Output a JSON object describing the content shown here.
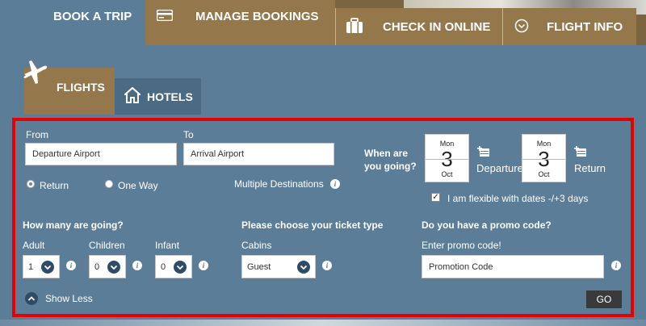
{
  "nav": {
    "book_label": "BOOK A TRIP",
    "manage_label": "MANAGE BOOKINGS",
    "checkin_label": "CHECK IN ONLINE",
    "info_label": "FLIGHT INFO"
  },
  "tabs": {
    "flights_label": "FLIGHTS",
    "hotels_label": "HOTELS"
  },
  "form": {
    "from_label": "From",
    "from_value": "Departure Airport",
    "to_label": "To",
    "to_value": "Arrival Airport",
    "trip_types": [
      "Return",
      "One Way"
    ],
    "selected_trip_type": "Return",
    "multi_dest_label": "Multiple Destinations",
    "when_label_line1": "When are",
    "when_label_line2": "you going?",
    "departure": {
      "dow": "Mon",
      "day": "3",
      "month": "Oct",
      "label": "Departure"
    },
    "return": {
      "dow": "Mon",
      "day": "3",
      "month": "Oct",
      "label": "Return"
    },
    "flexible_label": "I am flexible with dates -/+3 days",
    "flexible_checked": true,
    "passengers_heading": "How many are going?",
    "adult_label": "Adult",
    "adult_value": "1",
    "children_label": "Children",
    "children_value": "0",
    "infant_label": "Infant",
    "infant_value": "0",
    "ticket_heading": "Please choose your ticket type",
    "cabins_label": "Cabins",
    "cabins_value": "Guest",
    "promo_heading": "Do you have a promo code?",
    "promo_label": "Enter promo code!",
    "promo_value": "Promotion Code",
    "show_less_label": "Show Less",
    "go_label": "GO"
  },
  "colors": {
    "panel": "#5b7d97",
    "tab_gold": "#94784b",
    "highlight_border": "#e60000",
    "dark_button": "#3a3a3a"
  }
}
